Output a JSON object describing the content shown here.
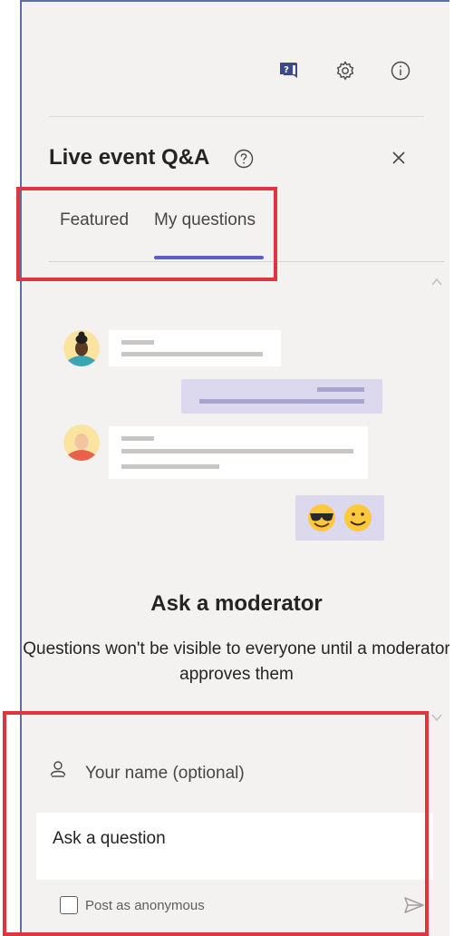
{
  "panel": {
    "title": "Live event Q&A"
  },
  "toolbar": {
    "icons": [
      "qa-chat-icon",
      "settings-gear-icon",
      "info-icon"
    ]
  },
  "tabs": [
    {
      "label": "Featured",
      "selected": false
    },
    {
      "label": "My questions",
      "selected": true
    }
  ],
  "empty_state": {
    "title": "Ask a moderator",
    "description": "Questions won't be visible to everyone until a moderator approves them"
  },
  "compose": {
    "name_placeholder": "Your name (optional)",
    "question_placeholder": "Ask a question",
    "anonymous_label": "Post as anonymous",
    "anonymous_checked": false
  },
  "colors": {
    "accent": "#5b5fc7",
    "highlight": "#e0353f",
    "panel_bg": "#f3f2f1"
  }
}
